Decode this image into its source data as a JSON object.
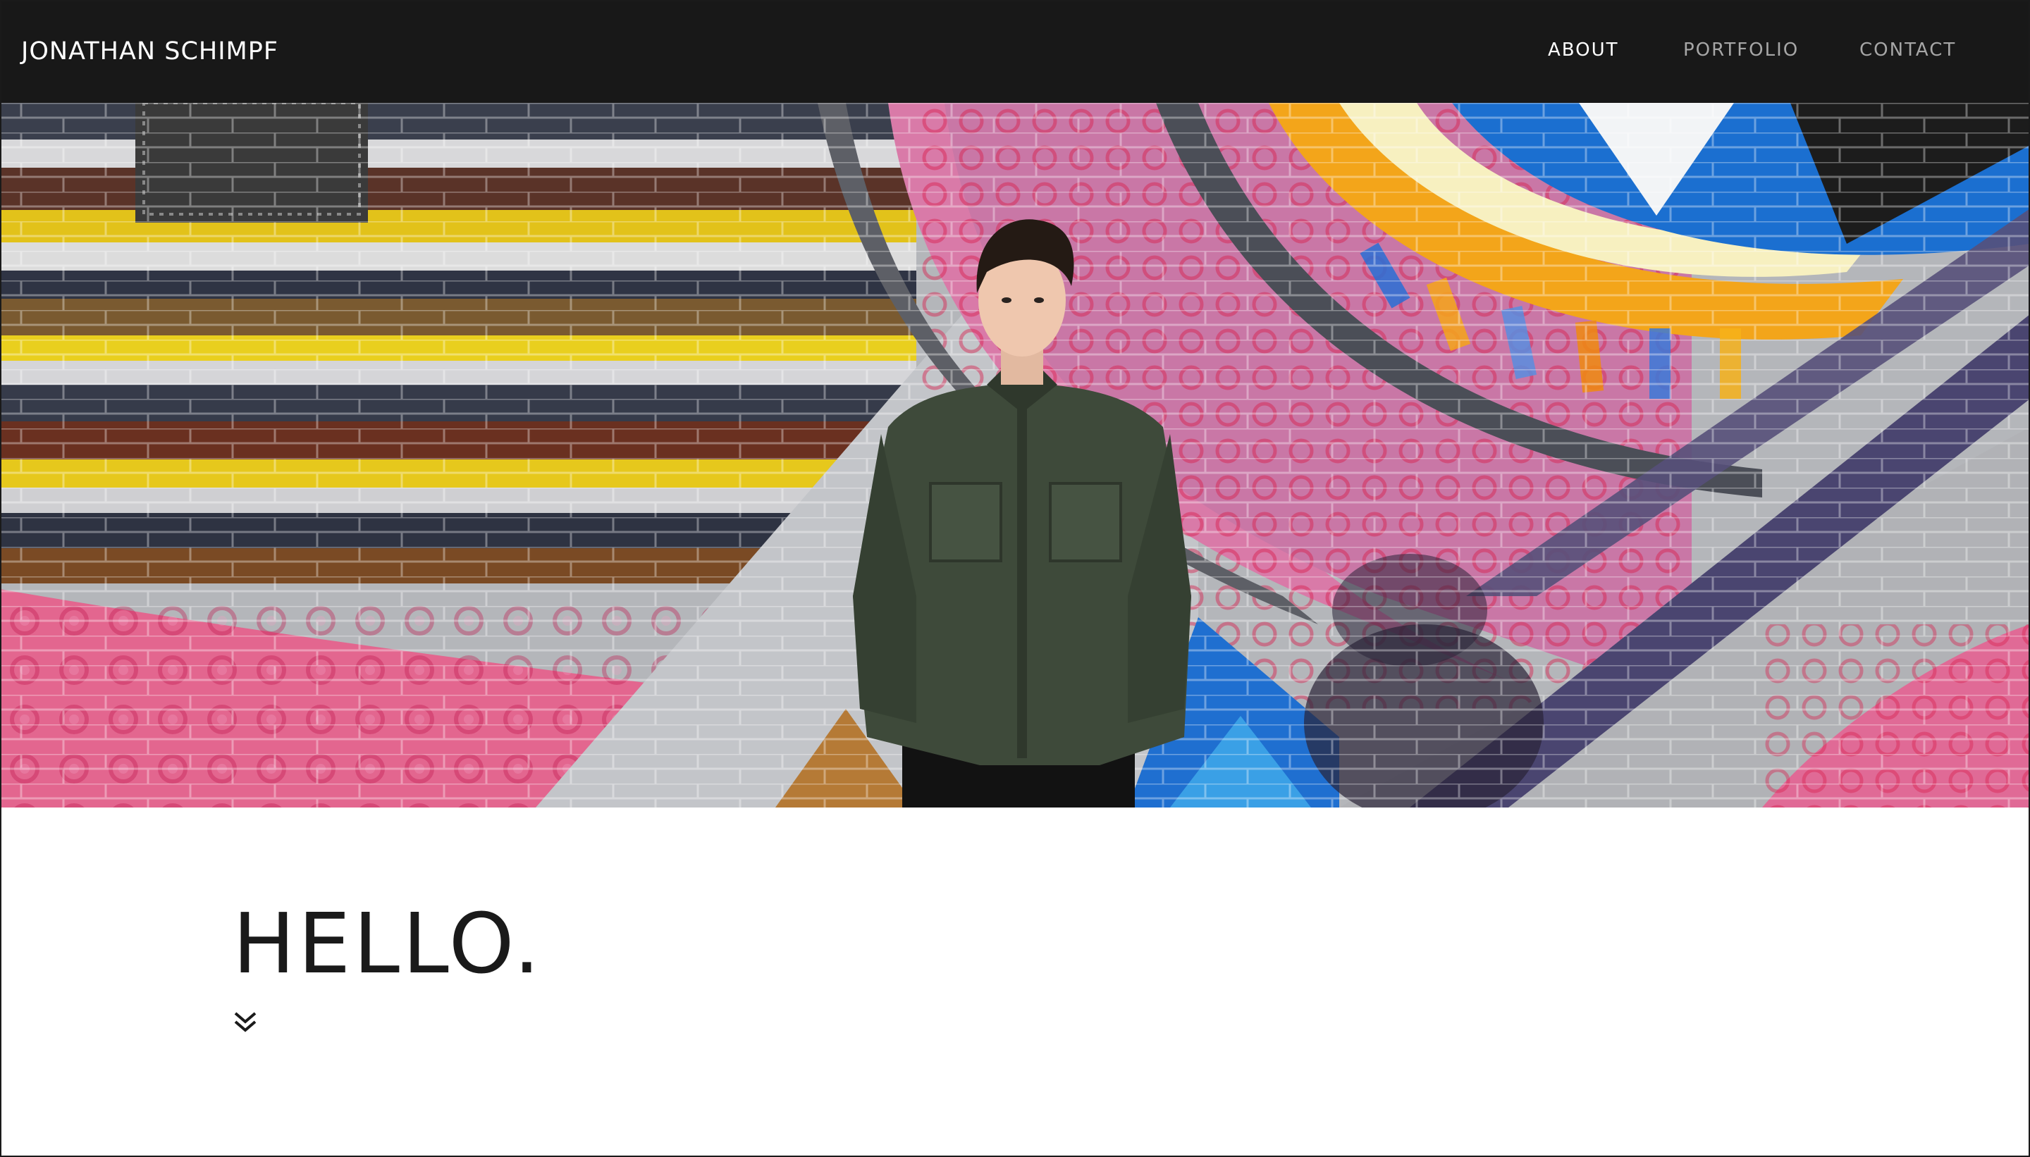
{
  "header": {
    "brand": "JONATHAN SCHIMPF",
    "background_color": "#181818"
  },
  "nav": {
    "items": [
      {
        "label": "ABOUT",
        "active": true
      },
      {
        "label": "PORTFOLIO",
        "active": false
      },
      {
        "label": "CONTACT",
        "active": false
      }
    ],
    "active_color": "#ffffff",
    "inactive_color": "#a6a6a6"
  },
  "hero": {
    "image": "portrait-in-front-of-mural"
  },
  "intro": {
    "heading": "HELLO.",
    "scroll_icon": "double-chevron-down-icon"
  }
}
